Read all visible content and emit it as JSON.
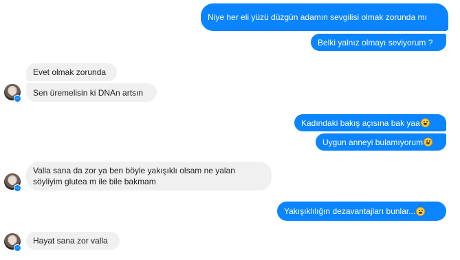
{
  "messages": {
    "m1": "Niye her eli yüzü düzgün adamın sevgilisi olmak zorunda mı",
    "m2": "Belki yalnız olmayı seviyorum ?",
    "m3": "Evet olmak zorunda",
    "m4": "Sen üremelisin ki DNAn artsın",
    "m5": "Kadındaki bakış açısına bak yaa",
    "m6": "Uygun anneyi bulamıyorum",
    "m7": "Valla sana da zor ya ben böyle yakışıklı olsam ne yalan söyliyim glutea m ile bile bakmam",
    "m8": "Yakışıklılığın dezavantajları bunlar... ",
    "m9": "Hayat sana zor valla"
  },
  "colors": {
    "outgoing_bubble": "#0b84ff",
    "incoming_bubble": "#f1f0f0"
  },
  "icons": {
    "emoji": "laughing-face-icon",
    "badge": "messenger-badge-icon"
  }
}
